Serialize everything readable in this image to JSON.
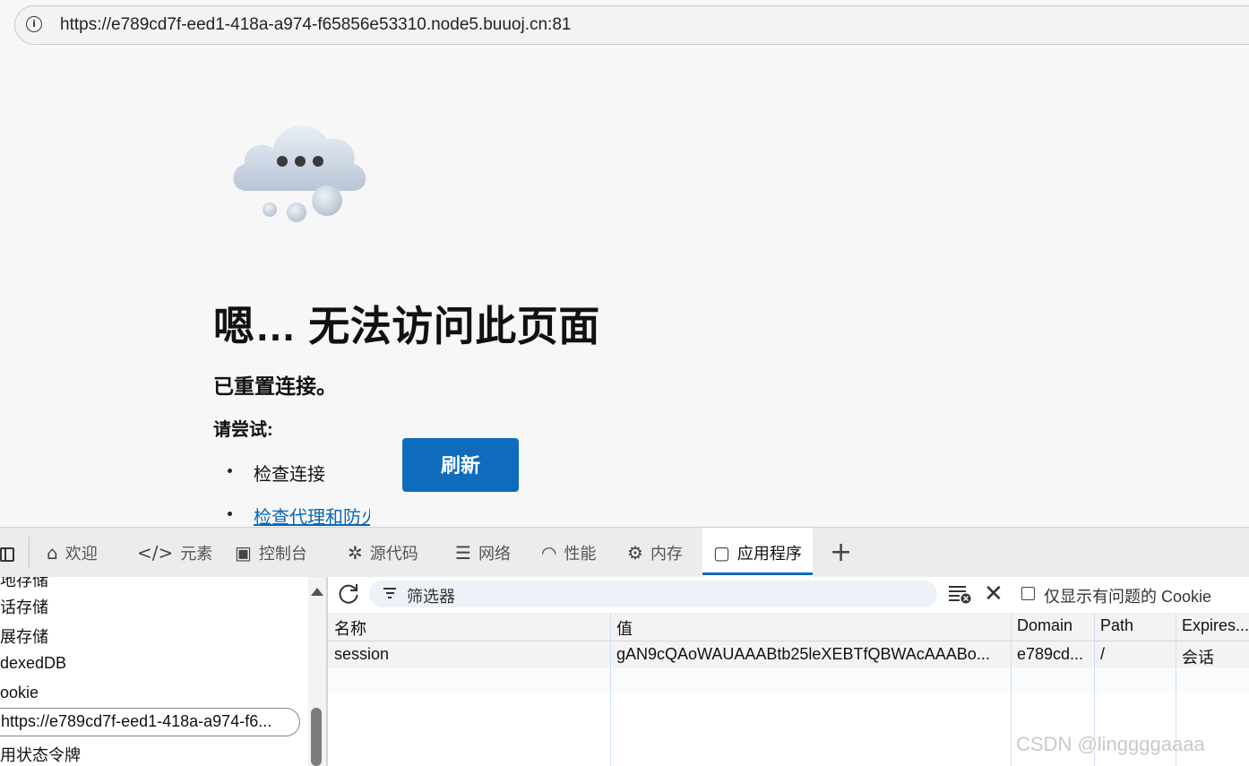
{
  "browser": {
    "url": "https://e789cd7f-eed1-418a-a974-f65856e53310.node5.buuoj.cn:81",
    "info_icon": "info-icon"
  },
  "error_page": {
    "title": "嗯… 无法访问此页面",
    "subtitle": "已重置连接。",
    "try_heading": "请尝试:",
    "suggestions": [
      "检查连接",
      "检查代理和防火墙"
    ],
    "refresh_button": "刷新",
    "illustration": "cloud-icon",
    "link_color": "#0b66b3",
    "accent_color": "#0f6cbd"
  },
  "devtools": {
    "tabs": [
      {
        "label": "欢迎",
        "icon": "home-icon"
      },
      {
        "label": "元素",
        "icon": "code-icon"
      },
      {
        "label": "控制台",
        "icon": "console-icon"
      },
      {
        "label": "源代码",
        "icon": "bug-icon"
      },
      {
        "label": "网络",
        "icon": "wifi-icon"
      },
      {
        "label": "性能",
        "icon": "gauge-icon"
      },
      {
        "label": "内存",
        "icon": "chip-icon"
      },
      {
        "label": "应用程序",
        "icon": "app-window-icon",
        "active": true
      }
    ],
    "sidebar": {
      "items": [
        "地存储",
        "话存储",
        "展存储",
        "dexedDB",
        "ookie",
        "https://e789cd7f-eed1-418a-a974-f6...",
        "用状态令牌"
      ],
      "selected_index": 5
    },
    "toolbar": {
      "filter_placeholder": "筛选器",
      "only_issues_label": "仅显示有问题的 Cookie",
      "only_issues_checked": false
    },
    "table": {
      "columns": [
        "名称",
        "值",
        "Domain",
        "Path",
        "Expires..."
      ],
      "rows": [
        [
          "session",
          "gAN9cQAoWAUAAABtb25leXEBTfQBWAcAAABo...",
          "e789cd...",
          "/",
          "会话"
        ]
      ]
    }
  },
  "watermark": "CSDN @linggggaaaa"
}
